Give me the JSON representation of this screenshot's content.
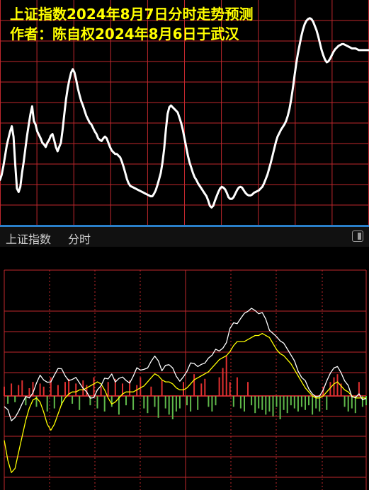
{
  "forecast": {
    "title_line1": "上证指数2024年8月7日分时走势预测",
    "title_line2": "作者：陈自权2024年8月6日于武汉",
    "colors": {
      "background": "#000000",
      "grid": "#c0272d",
      "line": "#ffffff",
      "title": "#ffff00"
    },
    "chart_data": {
      "type": "line",
      "series": [
        {
          "values": [
            112,
            118,
            128,
            140,
            152,
            160,
            168,
            174,
            162,
            130,
            102,
            98,
            104,
            120,
            133,
            148,
            163,
            176,
            188,
            197,
            180,
            176,
            168,
            164,
            160,
            155,
            153,
            150,
            155,
            158,
            163,
            165,
            158,
            150,
            145,
            150,
            155,
            170,
            188,
            205,
            218,
            228,
            236,
            240,
            236,
            228,
            218,
            210,
            203,
            198,
            192,
            186,
            182,
            178,
            176,
            172,
            168,
            165,
            160,
            158,
            157,
            160,
            162,
            160,
            155,
            150,
            146,
            144,
            142,
            142,
            140,
            138,
            133,
            127,
            120,
            113,
            108,
            105,
            104,
            103,
            102,
            101,
            100,
            99,
            98,
            97,
            96,
            95,
            94,
            93,
            93,
            96,
            100,
            106,
            113,
            120,
            132,
            148,
            170,
            188,
            196,
            198,
            196,
            194,
            192,
            190,
            184,
            178,
            170,
            160,
            150,
            140,
            132,
            126,
            120,
            115,
            112,
            108,
            105,
            102,
            99,
            96,
            93,
            88,
            82,
            80,
            82,
            88,
            93,
            98,
            102,
            104,
            103,
            101,
            97,
            92,
            90,
            90,
            92,
            96,
            100,
            103,
            104,
            103,
            100,
            97,
            95,
            94,
            94,
            95,
            97,
            98,
            99,
            100,
            102,
            104,
            108,
            113,
            118,
            125,
            132,
            140,
            148,
            156,
            162,
            166,
            170,
            173,
            176,
            180,
            186,
            194,
            205,
            218,
            232,
            246,
            258,
            268,
            278,
            286,
            292,
            296,
            298,
            299,
            298,
            295,
            290,
            285,
            278,
            270,
            262,
            256,
            251,
            248,
            249,
            252,
            256,
            260,
            263,
            265,
            267,
            268,
            269,
            269,
            268,
            267,
            266,
            265,
            264,
            264,
            264,
            263,
            262,
            262,
            262,
            262,
            262,
            262,
            262
          ]
        }
      ],
      "ylim": [
        60,
        320
      ]
    }
  },
  "realtime": {
    "header_name": "上证指数",
    "header_mode": "分时",
    "colors": {
      "background": "#000000",
      "grid": "#c0272d",
      "price_line": "#ffffff",
      "avg_line": "#ffff00",
      "up_bar": "#e03030",
      "down_bar": "#5fb84a",
      "accent": "#2a7fc9"
    },
    "chart_data": {
      "type": "line",
      "series": [
        {
          "name": "price",
          "values": [
            -5.3,
            -6.8,
            -12.3,
            -10.7,
            -7.7,
            -3.8,
            -0.3,
            -1.0,
            1.5,
            6.4,
            10.3,
            7.9,
            6.8,
            7.0,
            10.4,
            13.6,
            13.5,
            10.0,
            7.6,
            8.2,
            9.2,
            6.5,
            3.8,
            2.0,
            -1.1,
            -0.8,
            3.0,
            5.1,
            8.8,
            8.5,
            10.9,
            6.9,
            8.7,
            9.4,
            7.7,
            6.4,
            9.8,
            14.0,
            12.8,
            13.2,
            13.9,
            17.2,
            19.8,
            17.4,
            12.5,
            15.2,
            15.5,
            13.9,
            9.8,
            7.3,
            9.5,
            12.2,
            16.4,
            16.1,
            14.6,
            15.7,
            16.3,
            18.8,
            20.2,
            23.2,
            22.3,
            23.7,
            26.5,
            33.5,
            36.3,
            35.9,
            38.5,
            41.0,
            42.0,
            43.5,
            42.4,
            40.8,
            41.4,
            38.1,
            32.6,
            31.0,
            29.4,
            27.3,
            26.2,
            23.3,
            20.3,
            17.4,
            12.3,
            9.2,
            7.6,
            3.5,
            1.0,
            -0.4,
            0.0,
            2.9,
            7.4,
            11.3,
            13.9,
            14.6,
            11.5,
            7.5,
            5.2,
            -0.4,
            -0.8,
            1.1,
            -1.9,
            -1.2
          ]
        },
        {
          "name": "avg",
          "values": [
            -22,
            -32,
            -38,
            -36,
            -28,
            -20,
            -12,
            -6,
            -2,
            -1,
            -3,
            -8,
            -14,
            -17,
            -14,
            -9,
            -4,
            -1,
            1,
            2,
            2,
            3,
            3,
            4,
            5,
            6,
            7,
            6,
            3,
            -1,
            -4,
            -3,
            -1,
            1,
            2,
            2,
            2,
            3,
            4,
            5,
            7,
            9,
            11,
            10,
            8,
            7,
            7,
            6,
            4,
            3,
            3,
            4,
            6,
            8,
            9,
            10,
            11,
            12,
            14,
            16,
            18,
            19,
            20,
            22,
            25,
            27,
            27,
            27,
            28,
            29,
            30,
            30,
            31,
            30,
            29,
            26,
            23,
            21,
            20,
            18,
            16,
            13,
            10,
            7,
            4,
            2,
            0,
            -1,
            -1,
            0,
            2,
            4,
            6,
            7,
            5,
            3,
            2,
            0,
            -1,
            -1,
            -1,
            -1
          ]
        },
        {
          "name": "volume",
          "values": [
            6,
            -5,
            8,
            -4,
            7,
            10,
            -6,
            5,
            9,
            -7,
            8,
            6,
            -10,
            12,
            -8,
            7,
            -6,
            9,
            11,
            -5,
            8,
            -9,
            10,
            7,
            -6,
            12,
            -8,
            6,
            -10,
            9,
            -7,
            11,
            -12,
            8,
            -6,
            10,
            -9,
            7,
            12,
            -8,
            -11,
            6,
            -7,
            -14,
            10,
            -8,
            -12,
            -15,
            -10,
            -8,
            9,
            -6,
            -10,
            14,
            -9,
            8,
            11,
            -7,
            -10,
            -6,
            12,
            18,
            26,
            9,
            -7,
            12,
            -8,
            -10,
            9,
            -6,
            -11,
            -8,
            -9,
            -12,
            -10,
            -13,
            -7,
            -15,
            -9,
            -11,
            -6,
            -8,
            -10,
            -7,
            -9,
            -6,
            -12,
            -8,
            -10,
            6,
            -9,
            9,
            12,
            14,
            8,
            -7,
            -10,
            -8,
            -11,
            9,
            -7,
            -6
          ]
        }
      ],
      "ylim": [
        -45,
        60
      ]
    }
  }
}
